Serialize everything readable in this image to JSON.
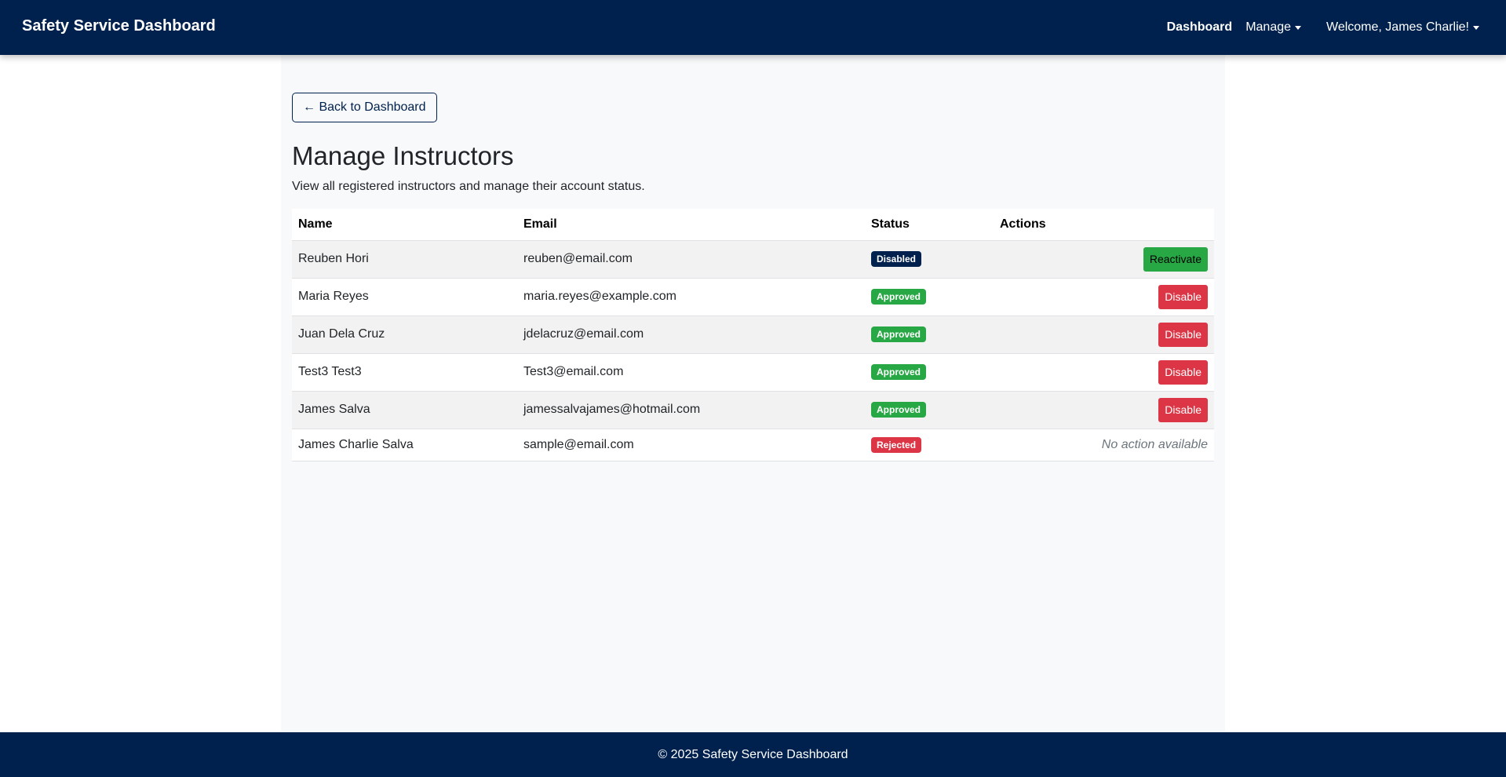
{
  "colors": {
    "navy": "#00214d",
    "success": "#28a745",
    "danger": "#dc3545",
    "content_bg": "#f8f9fa"
  },
  "navbar": {
    "brand": "Safety Service Dashboard",
    "links": {
      "dashboard": "Dashboard",
      "manage": "Manage",
      "user": "Welcome, James Charlie!"
    }
  },
  "main": {
    "back_button": "← Back to Dashboard",
    "title": "Manage Instructors",
    "subtitle": "View all registered instructors and manage their account status."
  },
  "table": {
    "columns": [
      "Name",
      "Email",
      "Status",
      "Actions"
    ],
    "rows": [
      {
        "name": "Reuben Hori",
        "email": "reuben@email.com",
        "status": "Disabled",
        "status_color": "#00214d",
        "action": "Reactivate",
        "action_color": "#28a745",
        "action_text_color": "#000000"
      },
      {
        "name": "Maria Reyes",
        "email": "maria.reyes@example.com",
        "status": "Approved",
        "status_color": "#28a745",
        "action": "Disable",
        "action_color": "#dc3545",
        "action_text_color": "#ffffff"
      },
      {
        "name": "Juan Dela Cruz",
        "email": "jdelacruz@email.com",
        "status": "Approved",
        "status_color": "#28a745",
        "action": "Disable",
        "action_color": "#dc3545",
        "action_text_color": "#ffffff"
      },
      {
        "name": "Test3 Test3",
        "email": "Test3@email.com",
        "status": "Approved",
        "status_color": "#28a745",
        "action": "Disable",
        "action_color": "#dc3545",
        "action_text_color": "#ffffff"
      },
      {
        "name": "James Salva",
        "email": "jamessalvajames@hotmail.com",
        "status": "Approved",
        "status_color": "#28a745",
        "action": "Disable",
        "action_color": "#dc3545",
        "action_text_color": "#ffffff"
      },
      {
        "name": "James Charlie Salva",
        "email": "sample@email.com",
        "status": "Rejected",
        "status_color": "#dc3545",
        "action": null,
        "no_action_text": "No action available"
      }
    ]
  },
  "footer": {
    "text": "© 2025 Safety Service Dashboard"
  }
}
